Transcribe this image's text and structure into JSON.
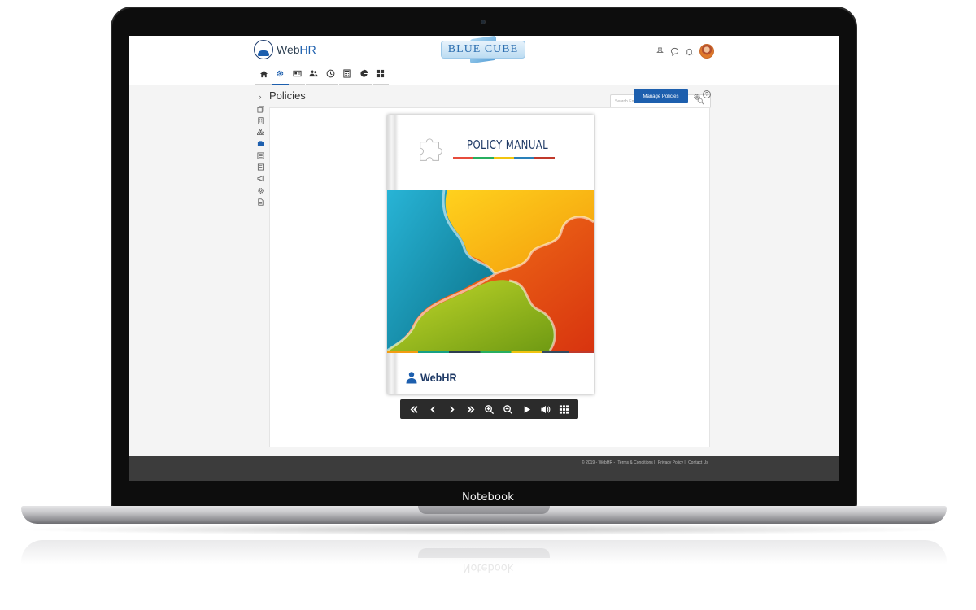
{
  "device": {
    "brand_label": "Notebook"
  },
  "header": {
    "app_name_prefix": "Web",
    "app_name_suffix": "HR",
    "company_badge": "BLUE CUBE",
    "top_icons": [
      "pin-icon",
      "chat-icon",
      "bell-icon",
      "avatar"
    ]
  },
  "nav": {
    "items": [
      "home-icon",
      "gear-icon",
      "id-card-icon",
      "people-icon",
      "clock-icon",
      "calculator-icon",
      "pie-chart-icon",
      "grid-icon"
    ],
    "active_index": 1
  },
  "search": {
    "placeholder": "Search Employees, Module, Help..."
  },
  "sidebar": {
    "items": [
      "copy-icon",
      "building-icon",
      "org-chart-icon",
      "briefcase-icon",
      "newspaper-icon",
      "book-icon",
      "megaphone-icon",
      "gear-icon",
      "document-icon"
    ],
    "active_index": 3
  },
  "page": {
    "title": "Policies",
    "manage_button": "Manage Policies",
    "help_glyph": "?"
  },
  "flipbook": {
    "cover_title": "POLICY MANUAL",
    "cover_logo": "WebHR",
    "toolbar": [
      "first-page-icon",
      "previous-page-icon",
      "next-page-icon",
      "last-page-icon",
      "zoom-in-icon",
      "zoom-out-icon",
      "play-icon",
      "volume-icon",
      "thumbnails-icon"
    ]
  },
  "footer": {
    "copyright": "© 2019 - WebHR -",
    "links": [
      "Terms & Conditions |",
      "Privacy Policy |",
      "Contact Us"
    ]
  },
  "colors": {
    "accent": "#1d5fae",
    "footer_bg": "#3c3c3c",
    "toolbar_bg": "#2b2b2b"
  }
}
